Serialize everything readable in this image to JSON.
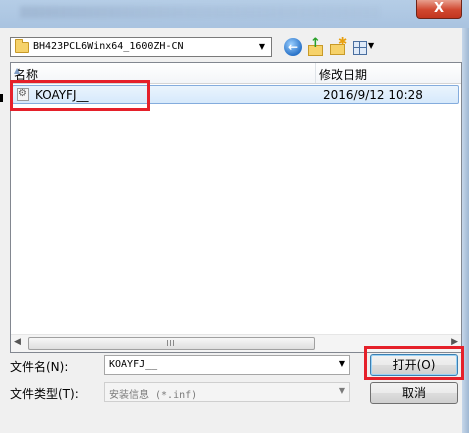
{
  "window": {
    "close_label": "X"
  },
  "toolbar": {
    "path": "BH423PCL6Winx64_1600ZH-CN",
    "icons": [
      "folder-icon",
      "back-icon",
      "up-folder-icon",
      "new-folder-icon",
      "view-menu-icon"
    ]
  },
  "file_list": {
    "columns": {
      "name": "名称",
      "date": "修改日期"
    },
    "rows": [
      {
        "name": "KOAYFJ__",
        "date": "2016/9/12 10:28",
        "icon": "inf-file-icon",
        "selected": true
      }
    ]
  },
  "form": {
    "filename_label": "文件名(N):",
    "filename_value": "KOAYFJ__",
    "filetype_label": "文件类型(T):",
    "filetype_value": "安装信息 (*.inf)",
    "open_label": "打开(O)",
    "cancel_label": "取消"
  },
  "colors": {
    "annotation_red": "#e5202a",
    "selection_fill": "#d6e9fb",
    "selection_border": "#84acdd"
  }
}
